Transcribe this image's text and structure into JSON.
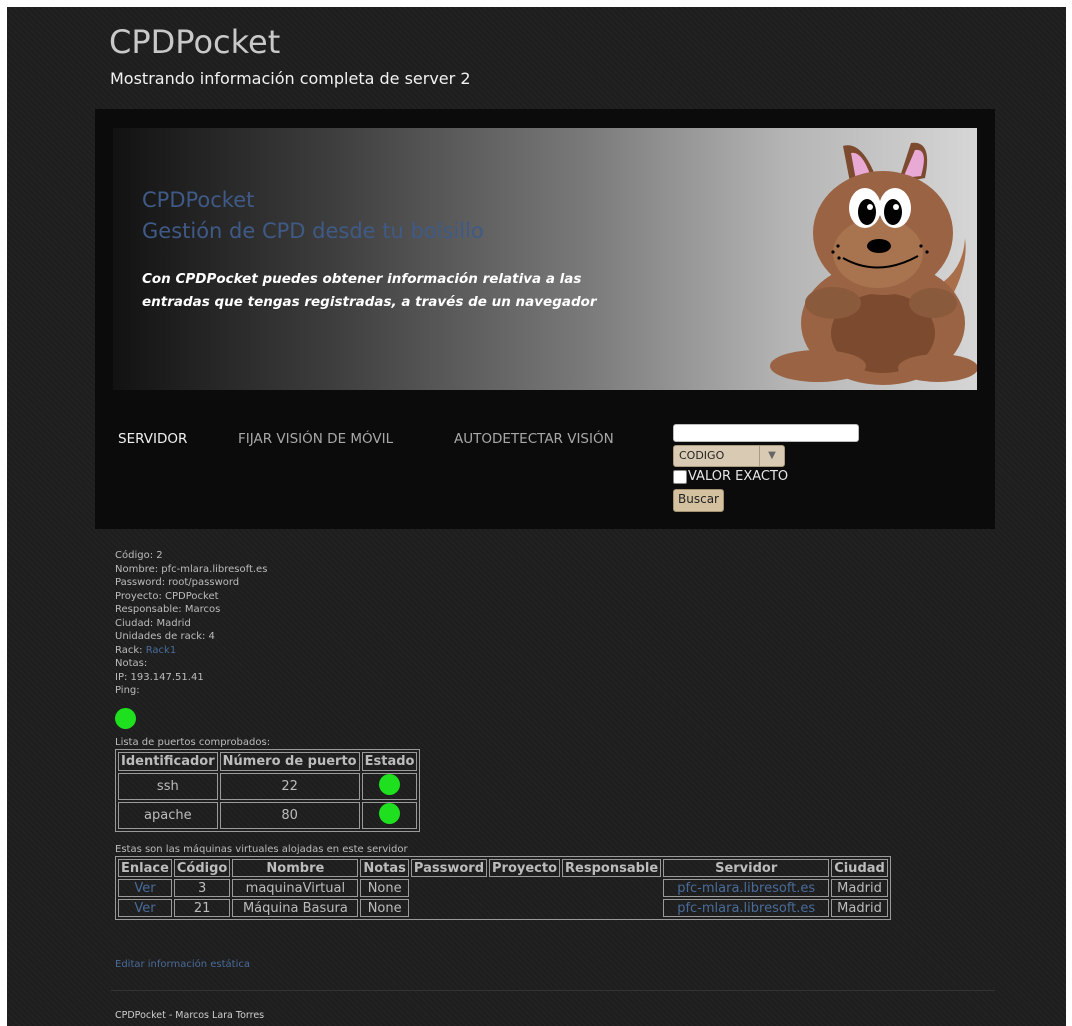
{
  "site": {
    "title": "CPDPocket",
    "subtitle": "Mostrando información completa de server 2"
  },
  "banner": {
    "title": "CPDPocket",
    "tagline": "Gestión de CPD desde tu bolsillo",
    "description": "Con CPDPocket puedes obtener información relativa a las entradas que tengas registradas, a través de un navegador"
  },
  "nav": {
    "items": [
      {
        "label": "SERVIDOR"
      },
      {
        "label": "FIJAR VISIÓN DE MÓVIL"
      },
      {
        "label": "AUTODETECTAR VISIÓN"
      }
    ]
  },
  "search": {
    "value": "",
    "field_selected": "CODIGO",
    "exact_label": "VALOR EXACTO",
    "exact_checked": false,
    "button_label": "Buscar"
  },
  "server": {
    "lines": {
      "codigo": "Código: 2",
      "nombre": "Nombre: pfc-mlara.libresoft.es",
      "password": "Password: root/password",
      "proyecto": "Proyecto: CPDPocket",
      "responsable": "Responsable: Marcos",
      "ciudad": "Ciudad: Madrid",
      "unidades": "Unidades de rack: 4",
      "rack_label": "Rack: ",
      "rack_link": "Rack1",
      "notas": "Notas:",
      "ip": "IP: 193.147.51.41",
      "ping": "Ping:"
    },
    "ping_status_color": "#1ee01e"
  },
  "ports": {
    "caption": "Lista de puertos comprobados:",
    "headers": [
      "Identificador",
      "Número de puerto",
      "Estado"
    ],
    "rows": [
      {
        "id": "ssh",
        "port": "22",
        "status": "ok"
      },
      {
        "id": "apache",
        "port": "80",
        "status": "ok"
      }
    ]
  },
  "vms": {
    "caption": "Estas son las máquinas virtuales alojadas en este servidor",
    "headers": [
      "Enlace",
      "Código",
      "Nombre",
      "Notas",
      "Password",
      "Proyecto",
      "Responsable",
      "Servidor",
      "Ciudad"
    ],
    "rows": [
      {
        "link": "Ver",
        "codigo": "3",
        "nombre": "maquinaVirtual",
        "notas": "None",
        "password": "",
        "proyecto": "",
        "responsable": "",
        "servidor": "pfc-mlara.libresoft.es",
        "ciudad": "Madrid"
      },
      {
        "link": "Ver",
        "codigo": "21",
        "nombre": "Máquina Basura",
        "notas": "None",
        "password": "",
        "proyecto": "",
        "responsable": "",
        "servidor": "pfc-mlara.libresoft.es",
        "ciudad": "Madrid"
      }
    ]
  },
  "edit_link": "Editar información estática",
  "footer": "CPDPocket - Marcos Lara Torres",
  "colors": {
    "background": "#1e1e1e",
    "header_box": "#0b0b0b",
    "link": "#4a6c9a",
    "status_ok": "#1ee01e",
    "button": "#d3c19f"
  }
}
